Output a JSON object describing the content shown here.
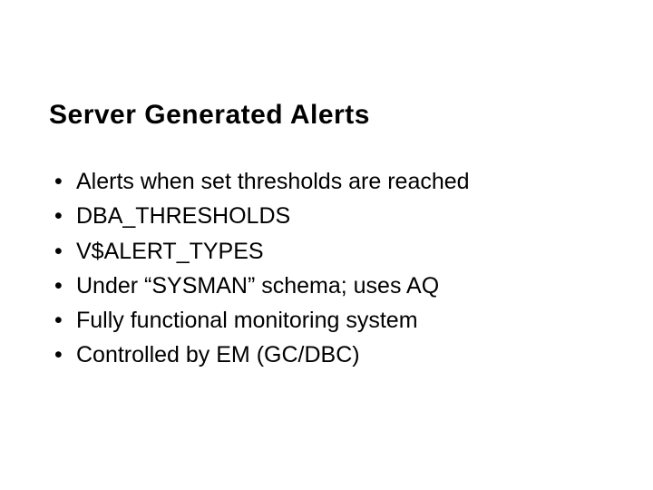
{
  "slide": {
    "title": "Server Generated Alerts",
    "bullets": [
      "Alerts when set thresholds are reached",
      "DBA_THRESHOLDS",
      "V$ALERT_TYPES",
      "Under “SYSMAN” schema; uses AQ",
      "Fully functional monitoring system",
      "Controlled by EM (GC/DBC)"
    ]
  }
}
